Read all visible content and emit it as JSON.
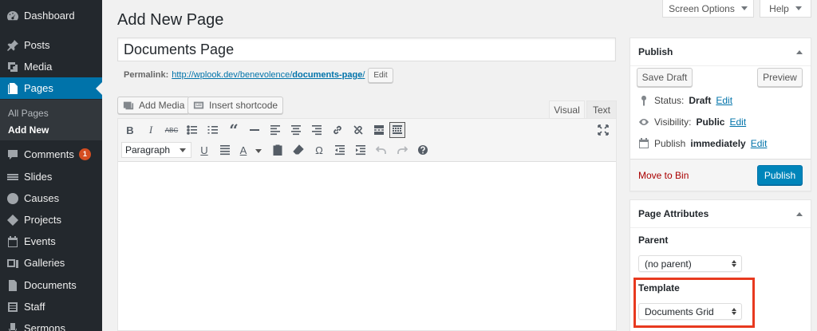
{
  "sidebar": {
    "items": [
      {
        "label": "Dashboard",
        "icon": "dashboard-icon"
      },
      {
        "label": "Posts",
        "icon": "pin-icon"
      },
      {
        "label": "Media",
        "icon": "media-icon"
      },
      {
        "label": "Pages",
        "icon": "pages-icon",
        "active": true
      },
      {
        "label": "Comments",
        "icon": "comment-icon",
        "badge": "1"
      },
      {
        "label": "Slides",
        "icon": "slides-icon"
      },
      {
        "label": "Causes",
        "icon": "causes-icon"
      },
      {
        "label": "Projects",
        "icon": "projects-icon"
      },
      {
        "label": "Events",
        "icon": "calendar-icon"
      },
      {
        "label": "Galleries",
        "icon": "gallery-icon"
      },
      {
        "label": "Documents",
        "icon": "document-icon"
      },
      {
        "label": "Staff",
        "icon": "staff-icon"
      },
      {
        "label": "Sermons",
        "icon": "sermons-icon"
      }
    ],
    "submenu": [
      "All Pages",
      "Add New"
    ]
  },
  "topbar": {
    "screen_options": "Screen Options",
    "help": "Help"
  },
  "page_title": "Add New Page",
  "post_title": "Documents Page",
  "permalink": {
    "label": "Permalink:",
    "url_prefix": "http://wplook.dev/benevolence/",
    "slug": "documents-page",
    "slash": "/",
    "edit": "Edit"
  },
  "media": {
    "add_media": "Add Media",
    "insert_shortcode": "Insert shortcode"
  },
  "editor_tabs": {
    "visual": "Visual",
    "text": "Text"
  },
  "toolbar": {
    "format": "Paragraph",
    "bold": "B",
    "italic": "I",
    "strike": "ABC",
    "blockquote": "“",
    "underline": "U",
    "color": "A",
    "omega": "Ω"
  },
  "publish_box": {
    "title": "Publish",
    "save_draft": "Save Draft",
    "preview": "Preview",
    "status_label": "Status:",
    "status_value": "Draft",
    "visibility_label": "Visibility:",
    "visibility_value": "Public",
    "publish_label": "Publish",
    "publish_value": "immediately",
    "edit": "Edit",
    "move_to_bin": "Move to Bin",
    "publish_button": "Publish"
  },
  "attributes_box": {
    "title": "Page Attributes",
    "parent_label": "Parent",
    "parent_value": "(no parent)",
    "template_label": "Template",
    "template_value": "Documents Grid"
  },
  "colors": {
    "accent": "#0073aa",
    "sidebar_bg": "#23282d",
    "highlight": "#e8391f",
    "trash": "#aa0000"
  }
}
